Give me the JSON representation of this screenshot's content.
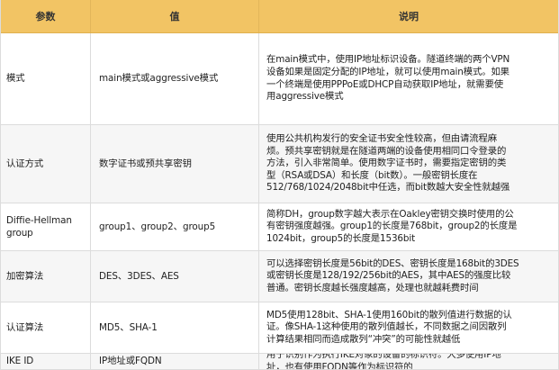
{
  "header": {
    "param": "参数",
    "value": "值",
    "desc": "说明"
  },
  "rows": [
    {
      "param": [
        "模式"
      ],
      "value": "main模式或aggressive模式",
      "desc": [
        "在main模式中，使用IP地址标识设备。隧道终端的两个VPN",
        "设备如果是固定分配的IP地址，就可以使用main模式。如果",
        "一个终端是使用PPPoE或DHCP自动获取IP地址，就需要使",
        "用aggressive模式"
      ]
    },
    {
      "param": [
        "认证方式"
      ],
      "value": "数字证书或预共享密钥",
      "desc": [
        "使用公共机构发行的安全证书安全性较高，但由请流程麻",
        "烦。预共享密钥就是在隧道两端的设备使用相同口令登录的",
        "方法，引入非常简单。使用数字证书时，需要指定密钥的类",
        "型（RSA或DSA）和长度（bit数）。一般密钥长度在",
        "512/768/1024/2048bit中任选，而bit数越大安全性就越强"
      ]
    },
    {
      "param": [
        "Diffie-Hellman",
        "group"
      ],
      "value": "group1、group2、group5",
      "desc": [
        "简称DH，group数字越大表示在Oakley密钥交换时使用的公",
        "有密钥强度越强。group1的长度是768bit，group2的长度是",
        "1024bit，group5的长度是1536bit"
      ]
    },
    {
      "param": [
        "加密算法"
      ],
      "value": "DES、3DES、AES",
      "desc": [
        "可以选择密钥长度是56bit的DES、密钥长度是168bit的3DES",
        "或密钥长度是128/192/256bit的AES，其中AES的强度比较",
        "普通。密钥长度越长强度越高，处理也就越耗费时间"
      ]
    },
    {
      "param": [
        "认证算法"
      ],
      "value": "MD5、SHA-1",
      "desc": [
        "MD5使用128bit、SHA-1使用160bit的散列值进行数据的认",
        "证。像SHA-1这种使用的散列值越长，不同数据之间因散列",
        "计算结果相同而造成散列“冲突”的可能性就越低"
      ]
    },
    {
      "param": [
        "IKE ID"
      ],
      "value": "IP地址或FQDN",
      "desc": [
        "用于识别作为执行IKE对象的设备的标识符。大多使用IP地",
        "址，也有使用FQDN等作为标识符的"
      ]
    }
  ]
}
